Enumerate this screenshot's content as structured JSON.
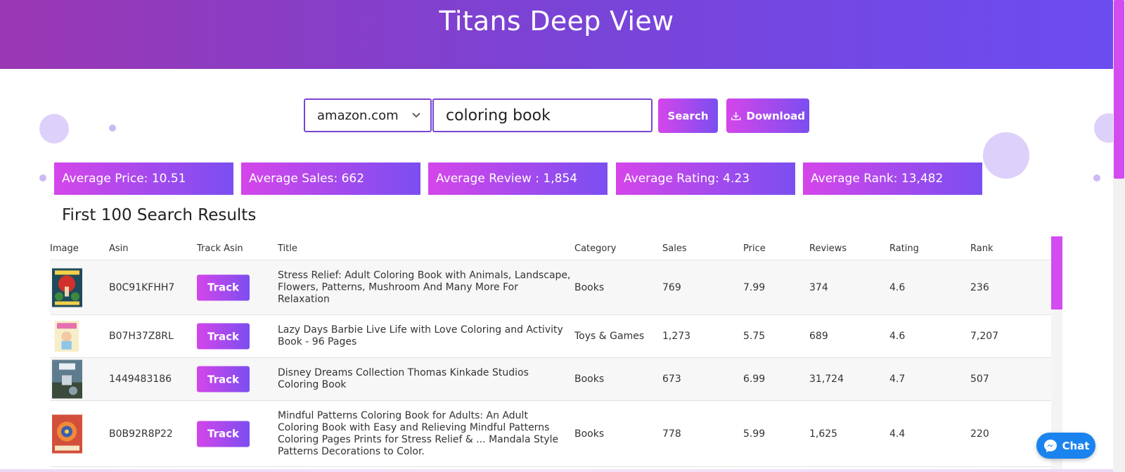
{
  "app": {
    "title": "Titans Deep View"
  },
  "search": {
    "marketplace": "amazon.com",
    "query": "coloring book",
    "search_label": "Search",
    "download_label": "Download"
  },
  "stats": [
    {
      "label": "Average Price: 10.51"
    },
    {
      "label": "Average Sales: 662"
    },
    {
      "label": "Average Review : 1,854"
    },
    {
      "label": "Average Rating: 4.23"
    },
    {
      "label": "Average Rank: 13,482"
    }
  ],
  "results": {
    "title": "First 100 Search Results",
    "columns": [
      "Image",
      "Asin",
      "Track Asin",
      "Title",
      "Category",
      "Sales",
      "Price",
      "Reviews",
      "Rating",
      "Rank"
    ],
    "track_label": "Track",
    "rows": [
      {
        "asin": "B0C91KFHH7",
        "title": "Stress Relief: Adult Coloring Book with Animals, Landscape, Flowers, Patterns, Mushroom And Many More For Relaxation",
        "category": "Books",
        "sales": "769",
        "price": "7.99",
        "reviews": "374",
        "rating": "4.6",
        "rank": "236"
      },
      {
        "asin": "B07H37Z8RL",
        "title": "Lazy Days Barbie Live Life with Love Coloring and Activity Book - 96 Pages",
        "category": "Toys & Games",
        "sales": "1,273",
        "price": "5.75",
        "reviews": "689",
        "rating": "4.6",
        "rank": "7,207"
      },
      {
        "asin": "1449483186",
        "title": "Disney Dreams Collection Thomas Kinkade Studios Coloring Book",
        "category": "Books",
        "sales": "673",
        "price": "6.99",
        "reviews": "31,724",
        "rating": "4.7",
        "rank": "507"
      },
      {
        "asin": "B0B92R8P22",
        "title": "Mindful Patterns Coloring Book for Adults: An Adult Coloring Book with Easy and Relieving Mindful Patterns Coloring Pages Prints for Stress Relief & ... Mandala Style Patterns Decorations to Color.",
        "category": "Books",
        "sales": "778",
        "price": "5.99",
        "reviews": "1,625",
        "rating": "4.4",
        "rank": "220"
      }
    ]
  },
  "chat": {
    "label": "Chat"
  },
  "colors": {
    "accent_pink": "#d446ea",
    "accent_purple": "#7b4ef0",
    "chat_blue": "#1a83ee"
  }
}
